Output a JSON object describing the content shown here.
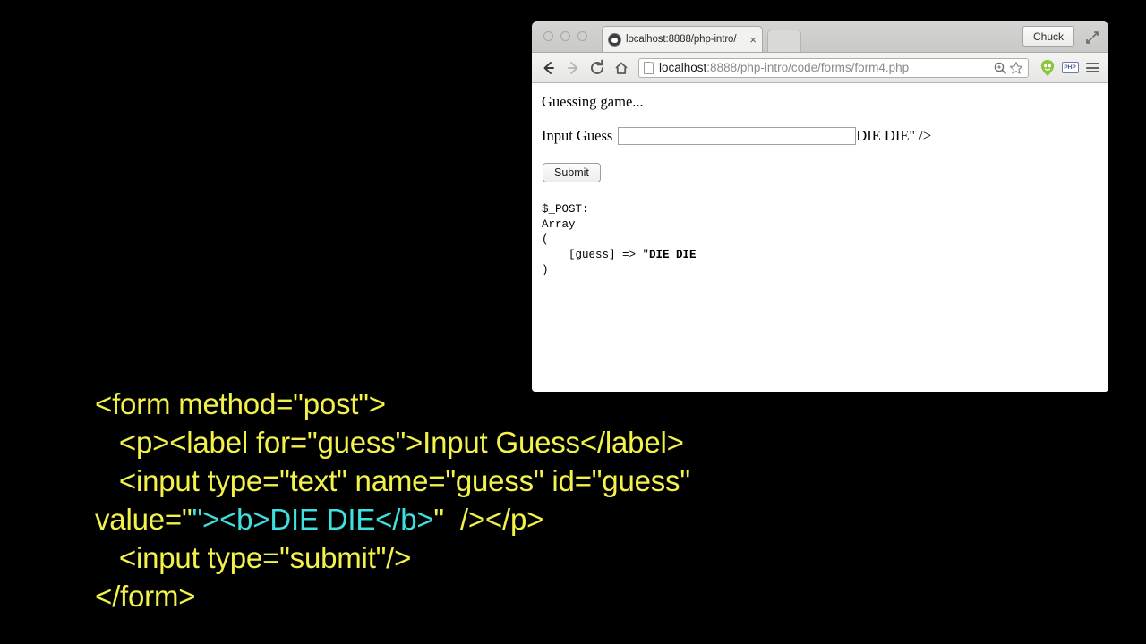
{
  "browser": {
    "traffic_lights": [
      "close",
      "minimize",
      "zoom"
    ],
    "tab": {
      "title": "localhost:8888/php-intro/",
      "favicon": "mamp-icon",
      "close_label": "×"
    },
    "new_tab_label": "",
    "profile_button_label": "Chuck",
    "expand_icon": "expand-diagonal-icon",
    "toolbar": {
      "back_icon": "back-arrow-icon",
      "forward_icon": "forward-arrow-icon",
      "reload_icon": "reload-icon",
      "home_icon": "home-icon",
      "page_icon": "page-document-icon",
      "url_host": "localhost",
      "url_path": ":8888/php-intro/code/forms/form4.php",
      "url_full": "localhost:8888/php-intro/code/forms/form4.php",
      "zoom_icon": "magnifier-icon",
      "bookmark_icon": "star-icon",
      "extension_icon": "evernote-icon",
      "php_badge_label": "PHP",
      "menu_icon": "hamburger-menu-icon"
    }
  },
  "page": {
    "heading": "Guessing game...",
    "form": {
      "label": "Input Guess",
      "input_value": "",
      "input_placeholder": "",
      "leaked_markup": "DIE DIE\" />",
      "submit_label": "Submit"
    },
    "post_dump": {
      "title": "$_POST:",
      "line_array": "Array",
      "line_open": "(",
      "entry_prefix": "    [guess] => \"",
      "entry_bold": "DIE DIE",
      "line_close": ")"
    }
  },
  "code_overlay": {
    "colors": {
      "base": "#f2f24b",
      "highlight": "#3ee0e0",
      "background": "#000000"
    },
    "lines": [
      {
        "segments": [
          {
            "t": "<form method=\"post\">",
            "c": "base"
          }
        ]
      },
      {
        "segments": [
          {
            "t": "   <p><label for=\"guess\">Input Guess</label>",
            "c": "base"
          }
        ]
      },
      {
        "segments": [
          {
            "t": "   <input type=\"text\" name=\"guess\" id=\"guess\"",
            "c": "base"
          }
        ]
      },
      {
        "segments": [
          {
            "t": "value=\"",
            "c": "base"
          },
          {
            "t": "\"><b>DIE DIE</b>",
            "c": "highlight"
          },
          {
            "t": "\"  /></p>",
            "c": "base"
          }
        ]
      },
      {
        "segments": [
          {
            "t": "   <input type=\"submit\"/>",
            "c": "base"
          }
        ]
      },
      {
        "segments": [
          {
            "t": "</form>",
            "c": "base"
          }
        ]
      }
    ]
  }
}
